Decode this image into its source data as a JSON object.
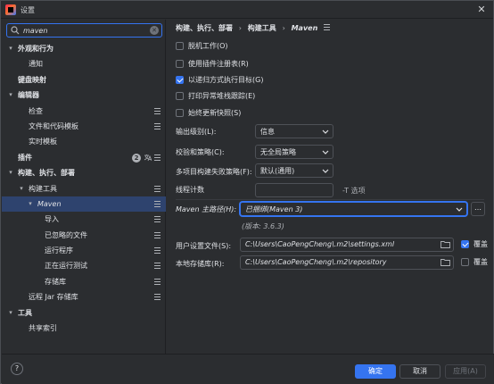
{
  "window": {
    "title": "设置",
    "close_glyph": "✕"
  },
  "search": {
    "value": "maven",
    "placeholder": "",
    "clear_glyph": "✕"
  },
  "sidebar": {
    "items": [
      {
        "label": "外观和行为",
        "arrow": "▾",
        "bold": true
      },
      {
        "label": "通知"
      },
      {
        "label": "键盘映射",
        "bold": true
      },
      {
        "label": "编辑器",
        "arrow": "▾",
        "bold": true
      },
      {
        "label": "检查"
      },
      {
        "label": "文件和代码模板"
      },
      {
        "label": "实时模板"
      },
      {
        "label": "插件",
        "bold": true,
        "badge": "2"
      },
      {
        "label": "构建、执行、部署",
        "arrow": "▾",
        "bold": true
      },
      {
        "label": "构建工具",
        "arrow": "▾"
      },
      {
        "label": "Maven",
        "arrow": "▾",
        "selected": true,
        "italic": true
      },
      {
        "label": "导入"
      },
      {
        "label": "已忽略的文件"
      },
      {
        "label": "运行程序"
      },
      {
        "label": "正在运行测试"
      },
      {
        "label": "存储库"
      },
      {
        "label": "远程 Jar 存储库"
      },
      {
        "label": "工具",
        "arrow": "▾",
        "bold": true
      },
      {
        "label": "共享索引"
      }
    ]
  },
  "breadcrumb": {
    "part1": "构建、执行、部署",
    "part2": "构建工具",
    "part3": "Maven",
    "sep": "›"
  },
  "options": {
    "offline": {
      "label": "脱机工作(O)",
      "checked": false
    },
    "plugin_registry": {
      "label": "使用插件注册表(R)",
      "checked": false
    },
    "recursive": {
      "label": "以递归方式执行目标(G)",
      "checked": true
    },
    "stacktrace": {
      "label": "打印异常堆栈跟踪(E)",
      "checked": false
    },
    "always_update": {
      "label": "始终更新快照(S)",
      "checked": false
    }
  },
  "output_level": {
    "label": "输出级别(L):",
    "value": "信息"
  },
  "checksum": {
    "label": "校验和策略(C):",
    "value": "无全局策略"
  },
  "fail_policy": {
    "label": "多项目构建失败策略(F):",
    "value": "默认(通用)"
  },
  "thread_count": {
    "label": "线程计数",
    "value": "",
    "hint": "-T 选项"
  },
  "maven_home": {
    "label": "Maven 主路径(H):",
    "value": "已捆绑(Maven 3)",
    "version": "(版本: 3.6.3)",
    "more": "…"
  },
  "user_settings": {
    "label": "用户设置文件(S):",
    "value": "C:\\Users\\CaoPengCheng\\.m2\\settings.xml",
    "override_label": "覆盖",
    "override": true
  },
  "local_repo": {
    "label": "本地存储库(R):",
    "value": "C:\\Users\\CaoPengCheng\\.m2\\repository",
    "override_label": "覆盖",
    "override": false
  },
  "footer": {
    "help": "?",
    "ok": "确定",
    "cancel": "取消",
    "apply": "应用(A)"
  },
  "colors": {
    "accent": "#3574f0",
    "selection": "#2e436e",
    "background": "#2b2d30"
  }
}
